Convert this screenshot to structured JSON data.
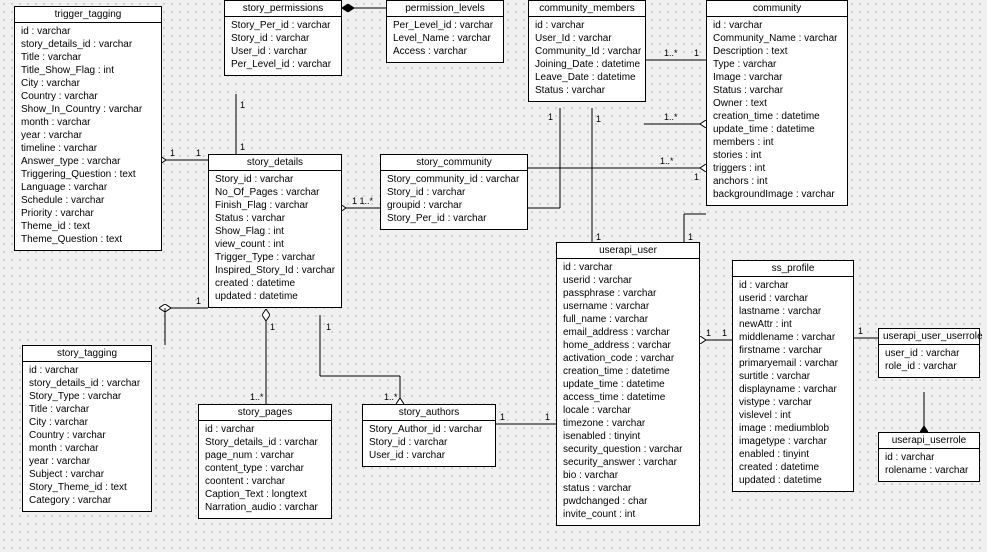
{
  "classes": {
    "trigger_tagging": {
      "title": "trigger_tagging",
      "attrs": [
        "id : varchar",
        "story_details_id : varchar",
        "Title : varchar",
        "Title_Show_Flag : int",
        "City : varchar",
        "Country : varchar",
        "Show_In_Country : varchar",
        "month : varchar",
        "year : varchar",
        "timeline : varchar",
        "Answer_type : varchar",
        "Triggering_Question : text",
        "Language : varchar",
        "Schedule : varchar",
        "Priority : varchar",
        "Theme_id : text",
        "Theme_Question : text"
      ]
    },
    "story_permissions": {
      "title": "story_permissions",
      "attrs": [
        "Story_Per_id : varchar",
        "Story_id : varchar",
        "User_id : varchar",
        "Per_Level_id : varchar"
      ]
    },
    "permission_levels": {
      "title": "permission_levels",
      "attrs": [
        "Per_Level_id : varchar",
        "Level_Name : varchar",
        "Access : varchar"
      ]
    },
    "community_members": {
      "title": "community_members",
      "attrs": [
        "id : varchar",
        "User_Id : varchar",
        "Community_Id : varchar",
        "Joining_Date : datetime",
        "Leave_Date : datetime",
        "Status : varchar"
      ]
    },
    "community": {
      "title": "community",
      "attrs": [
        "id : varchar",
        "Community_Name : varchar",
        "Description : text",
        "Type : varchar",
        "Image : varchar",
        "Status : varchar",
        "Owner : text",
        "creation_time : datetime",
        "update_time : datetime",
        "members : int",
        "stories : int",
        "triggers : int",
        "anchors : int",
        "backgroundImage : varchar"
      ]
    },
    "story_details": {
      "title": "story_details",
      "attrs": [
        "Story_id : varchar",
        "No_Of_Pages : varchar",
        "Finish_Flag : varchar",
        "Status : varchar",
        "Show_Flag : int",
        "view_count : int",
        "Trigger_Type : varchar",
        "Inspired_Story_Id : varchar",
        "created : datetime",
        "updated : datetime"
      ]
    },
    "story_community": {
      "title": "story_community",
      "attrs": [
        "Story_community_id : varchar",
        "Story_id : varchar",
        "groupid : varchar",
        "Story_Per_id : varchar"
      ]
    },
    "userapi_user": {
      "title": "userapi_user",
      "attrs": [
        "id : varchar",
        "userid : varchar",
        "passphrase : varchar",
        "username : varchar",
        "full_name : varchar",
        "email_address : varchar",
        "home_address : varchar",
        "activation_code : varchar",
        "creation_time : datetime",
        "update_time : datetime",
        "access_time : datetime",
        "locale : varchar",
        "timezone : varchar",
        "isenabled : tinyint",
        "security_question : varchar",
        "security_answer : varchar",
        "bio : varchar",
        "status : varchar",
        "pwdchanged : char",
        "invite_count : int"
      ]
    },
    "ss_profile": {
      "title": "ss_profile",
      "attrs": [
        "id : varchar",
        "userid : varchar",
        "lastname : varchar",
        "newAttr : int",
        "middlename : varchar",
        "firstname : varchar",
        "primaryemail : varchar",
        "surtitle : varchar",
        "displayname : varchar",
        "vistype : varchar",
        "vislevel : int",
        "image : mediumblob",
        "imagetype : varchar",
        "enabled : tinyint",
        "created : datetime",
        "updated : datetime"
      ]
    },
    "userapi_user_userrole": {
      "title": "userapi_user_userrole",
      "attrs": [
        "user_id : varchar",
        "role_id : varchar"
      ]
    },
    "userapi_userrole": {
      "title": "userapi_userrole",
      "attrs": [
        "id : varchar",
        "rolename : varchar"
      ]
    },
    "story_tagging": {
      "title": "story_tagging",
      "attrs": [
        "id : varchar",
        "story_details_id : varchar",
        "Story_Type : varchar",
        "Title : varchar",
        "City : varchar",
        "Country : varchar",
        "month : varchar",
        "year : varchar",
        "Subject : varchar",
        "Story_Theme_id : text",
        "Category : varchar"
      ]
    },
    "story_pages": {
      "title": "story_pages",
      "attrs": [
        "id : varchar",
        "Story_details_id : varchar",
        "page_num : varchar",
        "content_type : varchar",
        "coontent : varchar",
        "Caption_Text : longtext",
        "Narration_audio : varchar"
      ]
    },
    "story_authors": {
      "title": "story_authors",
      "attrs": [
        "Story_Author_id : varchar",
        "Story_id : varchar",
        "User_id : varchar"
      ]
    }
  }
}
